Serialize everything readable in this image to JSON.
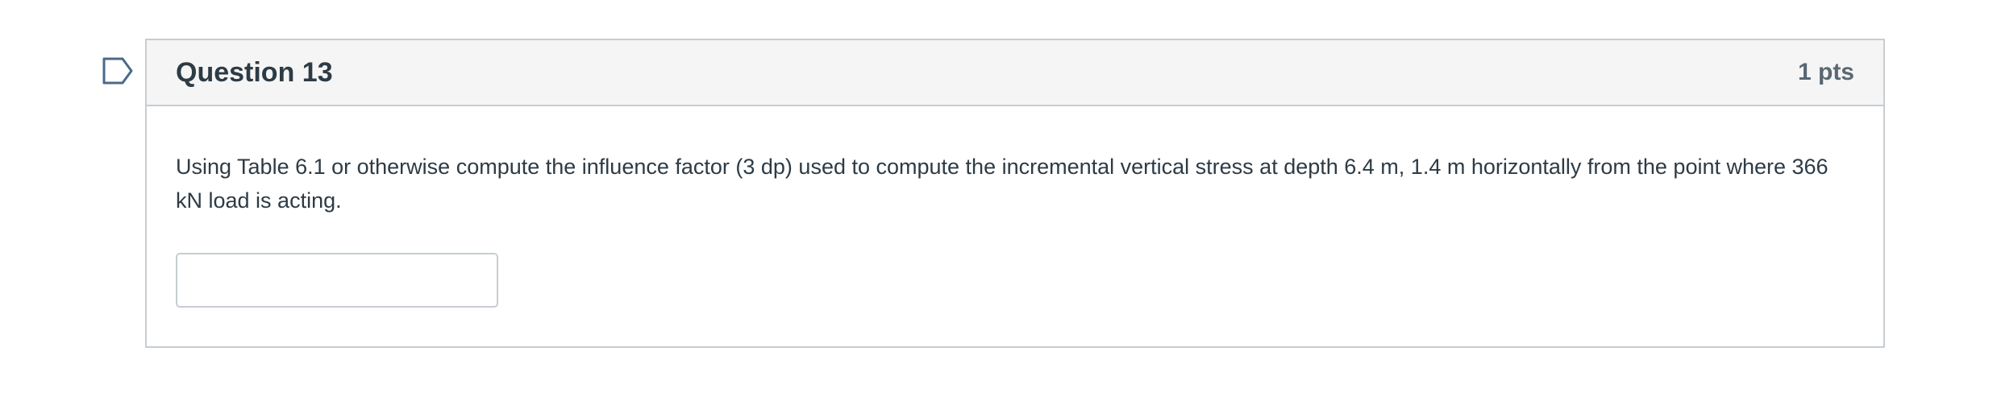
{
  "question": {
    "title": "Question 13",
    "points": "1 pts",
    "text": "Using Table 6.1 or otherwise compute the influence factor (3 dp) used to compute the incremental vertical stress at depth 6.4 m, 1.4 m horizontally from the point where 366 kN load is acting.",
    "answer_value": "",
    "answer_placeholder": ""
  },
  "icons": {
    "flag": "bookmark-flag-icon"
  },
  "colors": {
    "header_bg": "#f5f5f5",
    "border": "#c7cdd1",
    "text": "#2d3b45",
    "points": "#5a6872"
  }
}
